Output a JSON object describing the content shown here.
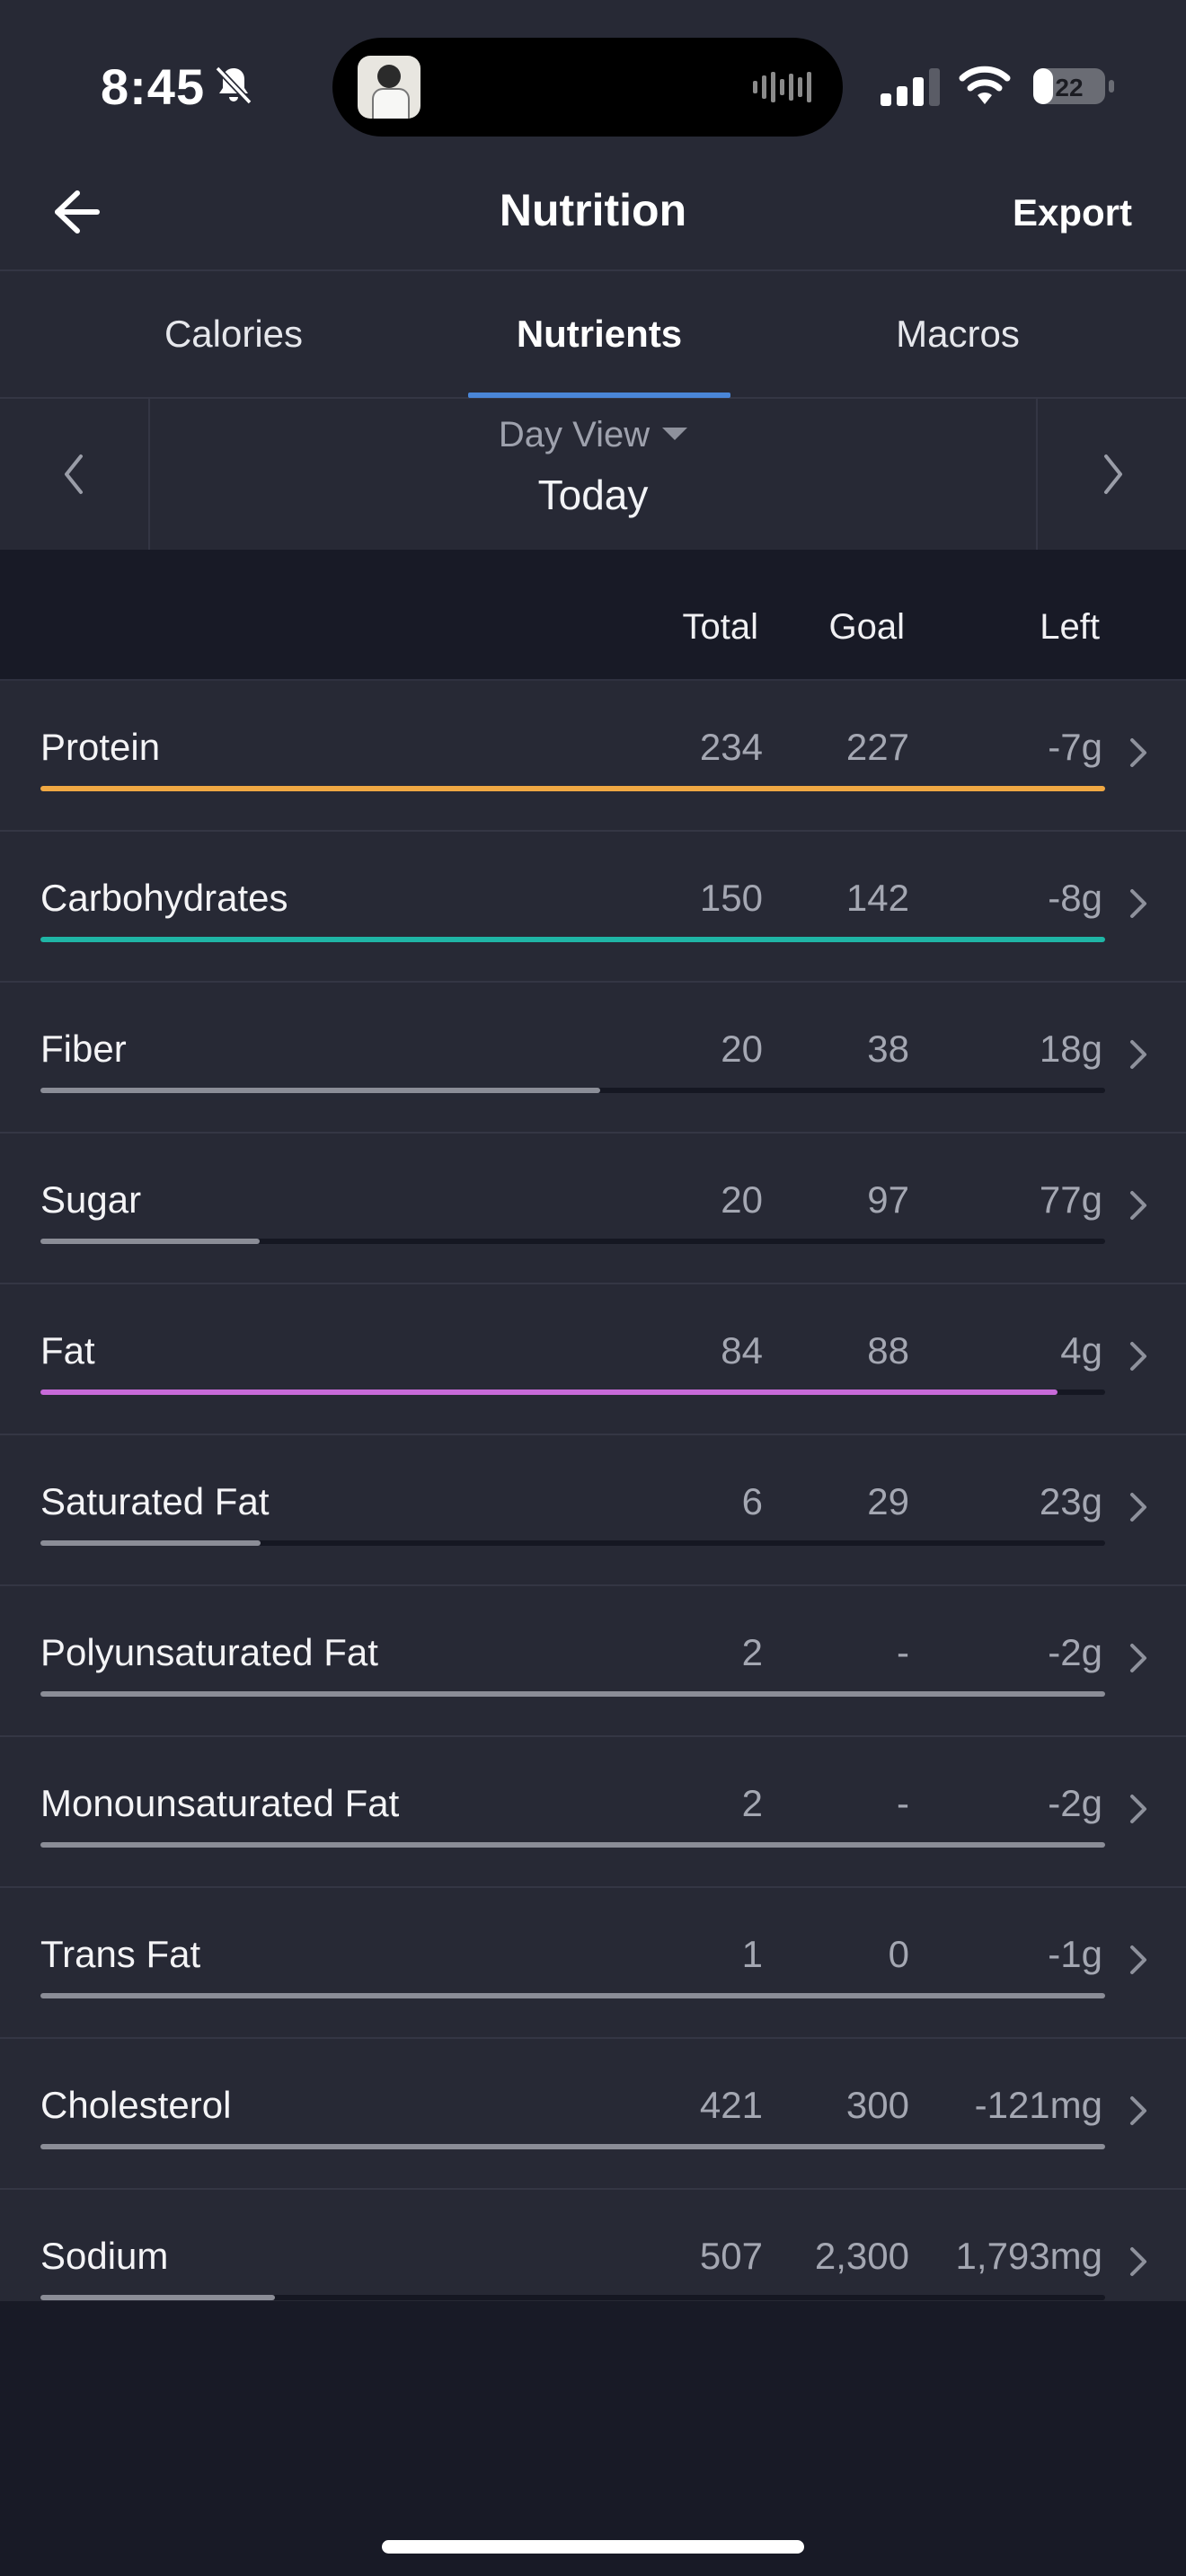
{
  "status_bar": {
    "time": "8:45",
    "battery": "22"
  },
  "header": {
    "title": "Nutrition",
    "export_label": "Export"
  },
  "tabs": [
    {
      "label": "Calories",
      "active": false
    },
    {
      "label": "Nutrients",
      "active": true
    },
    {
      "label": "Macros",
      "active": false
    }
  ],
  "day_selector": {
    "view_label": "Day View",
    "date_label": "Today"
  },
  "columns": {
    "total": "Total",
    "goal": "Goal",
    "left": "Left"
  },
  "nutrients": [
    {
      "name": "Protein",
      "total": "234",
      "goal": "227",
      "left": "-7g",
      "progress": 1.0,
      "color": "#f0a843"
    },
    {
      "name": "Carbohydrates",
      "total": "150",
      "goal": "142",
      "left": "-8g",
      "progress": 1.0,
      "color": "#1fb5a6"
    },
    {
      "name": "Fiber",
      "total": "20",
      "goal": "38",
      "left": "18g",
      "progress": 0.526,
      "color": "#8b8d97"
    },
    {
      "name": "Sugar",
      "total": "20",
      "goal": "97",
      "left": "77g",
      "progress": 0.206,
      "color": "#8b8d97"
    },
    {
      "name": "Fat",
      "total": "84",
      "goal": "88",
      "left": "4g",
      "progress": 0.955,
      "color": "#c76ad9"
    },
    {
      "name": "Saturated Fat",
      "total": "6",
      "goal": "29",
      "left": "23g",
      "progress": 0.207,
      "color": "#8b8d97"
    },
    {
      "name": "Polyunsaturated Fat",
      "total": "2",
      "goal": "-",
      "left": "-2g",
      "progress": 1.0,
      "color": "#8b8d97"
    },
    {
      "name": "Monounsaturated Fat",
      "total": "2",
      "goal": "-",
      "left": "-2g",
      "progress": 1.0,
      "color": "#8b8d97"
    },
    {
      "name": "Trans Fat",
      "total": "1",
      "goal": "0",
      "left": "-1g",
      "progress": 1.0,
      "color": "#8b8d97"
    },
    {
      "name": "Cholesterol",
      "total": "421",
      "goal": "300",
      "left": "-121mg",
      "progress": 1.0,
      "color": "#8b8d97"
    },
    {
      "name": "Sodium",
      "total": "507",
      "goal": "2,300",
      "left": "1,793mg",
      "progress": 0.22,
      "color": "#8b8d97"
    }
  ],
  "icons": {
    "back": "arrow-left-icon",
    "prev": "chevron-left-icon",
    "next": "chevron-right-icon",
    "row": "chevron-right-icon"
  }
}
